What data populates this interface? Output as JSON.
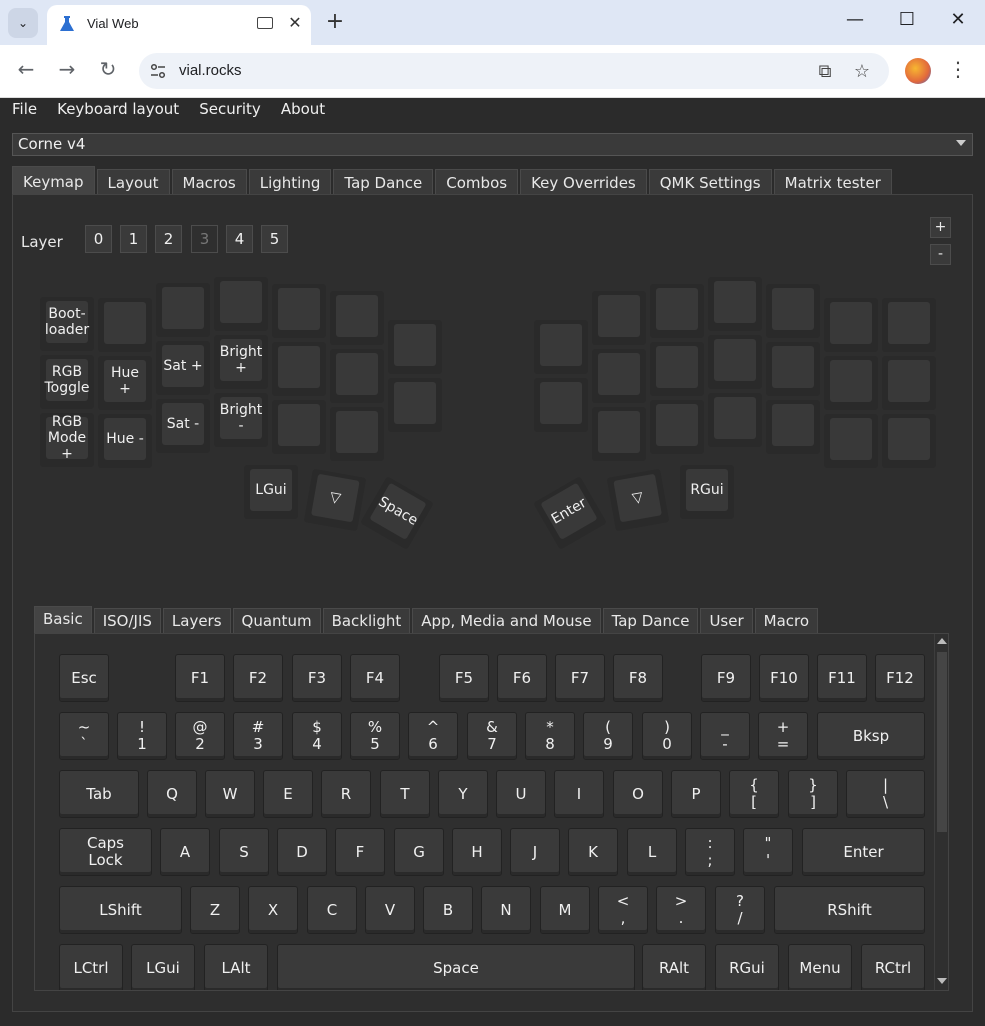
{
  "browser": {
    "tab_title": "Vial Web",
    "url": "vial.rocks"
  },
  "menubar": [
    "File",
    "Keyboard layout",
    "Security",
    "About"
  ],
  "device": "Corne v4",
  "main_tabs": [
    "Keymap",
    "Layout",
    "Macros",
    "Lighting",
    "Tap Dance",
    "Combos",
    "Key Overrides",
    "QMK Settings",
    "Matrix tester"
  ],
  "active_main_tab": "Keymap",
  "layer": {
    "label": "Layer",
    "buttons": [
      "0",
      "1",
      "2",
      "3",
      "4",
      "5"
    ],
    "active": "3"
  },
  "zoom": {
    "plus": "+",
    "minus": "-"
  },
  "layout_keys": {
    "left": [
      {
        "label": "Boot-\nloader"
      },
      {
        "label": ""
      },
      {
        "label": ""
      },
      {
        "label": ""
      },
      {
        "label": ""
      },
      {
        "label": ""
      },
      {
        "label": "RGB\nToggle"
      },
      {
        "label": "Hue +"
      },
      {
        "label": "Sat +"
      },
      {
        "label": "Bright +"
      },
      {
        "label": ""
      },
      {
        "label": ""
      },
      {
        "label": "RGB\nMode +"
      },
      {
        "label": "Hue -"
      },
      {
        "label": "Sat -"
      },
      {
        "label": "Bright -"
      },
      {
        "label": ""
      },
      {
        "label": ""
      }
    ],
    "left_outer": [
      "",
      ""
    ],
    "right_outer": [
      "",
      ""
    ],
    "right": [
      {
        "label": ""
      },
      {
        "label": ""
      },
      {
        "label": ""
      },
      {
        "label": ""
      },
      {
        "label": ""
      },
      {
        "label": ""
      },
      {
        "label": ""
      },
      {
        "label": ""
      },
      {
        "label": ""
      },
      {
        "label": ""
      },
      {
        "label": ""
      },
      {
        "label": ""
      },
      {
        "label": ""
      },
      {
        "label": ""
      },
      {
        "label": ""
      },
      {
        "label": ""
      },
      {
        "label": ""
      },
      {
        "label": ""
      }
    ],
    "thumbs_left": [
      "LGui",
      "▽",
      "Space"
    ],
    "thumbs_right": [
      "Enter",
      "▽",
      "RGui"
    ]
  },
  "sub_tabs": [
    "Basic",
    "ISO/JIS",
    "Layers",
    "Quantum",
    "Backlight",
    "App, Media and Mouse",
    "Tap Dance",
    "User",
    "Macro"
  ],
  "active_sub_tab": "Basic",
  "keyboard_rows": [
    [
      "Esc",
      "F1",
      "F2",
      "F3",
      "F4",
      "F5",
      "F6",
      "F7",
      "F8",
      "F9",
      "F10",
      "F11",
      "F12"
    ],
    [
      "~\n`",
      "!\n1",
      "@\n2",
      "#\n3",
      "$\n4",
      "%\n5",
      "^\n6",
      "&\n7",
      "*\n8",
      "(\n9",
      ")\n0",
      "_\n-",
      "+\n=",
      "Bksp"
    ],
    [
      "Tab",
      "Q",
      "W",
      "E",
      "R",
      "T",
      "Y",
      "U",
      "I",
      "O",
      "P",
      "{\n[",
      "}\n]",
      "|\n\\"
    ],
    [
      "Caps\nLock",
      "A",
      "S",
      "D",
      "F",
      "G",
      "H",
      "J",
      "K",
      "L",
      ":\n;",
      "\"\n'",
      "Enter"
    ],
    [
      "LShift",
      "Z",
      "X",
      "C",
      "V",
      "B",
      "N",
      "M",
      "<\n,",
      ">\n.",
      "?\n/",
      "RShift"
    ],
    [
      "LCtrl",
      "LGui",
      "LAlt",
      "Space",
      "RAlt",
      "RGui",
      "Menu",
      "RCtrl"
    ]
  ]
}
